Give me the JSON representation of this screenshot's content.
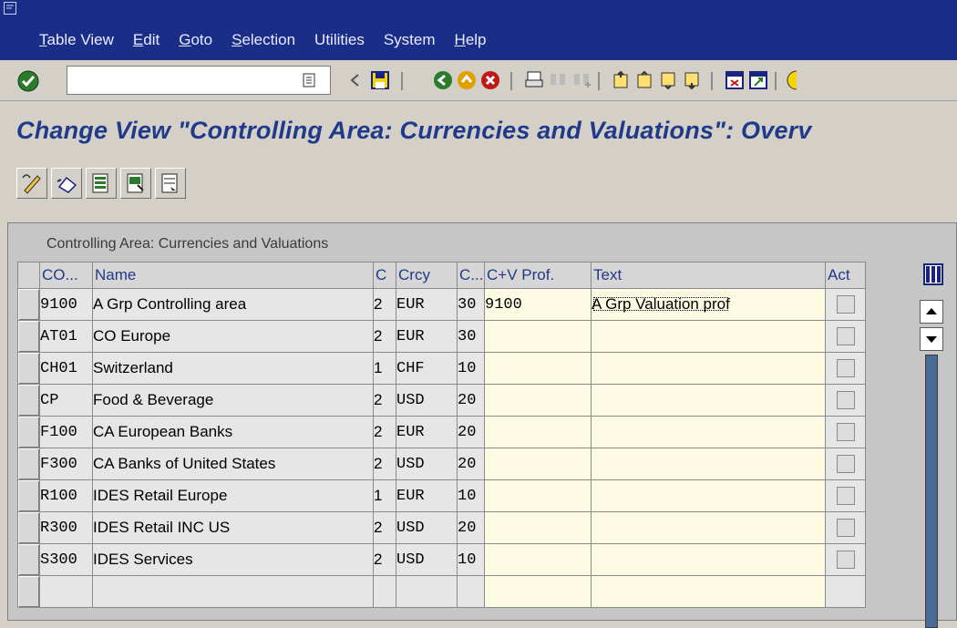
{
  "menu": [
    {
      "label": "Table View",
      "underline": "T"
    },
    {
      "label": "Edit",
      "underline": "E"
    },
    {
      "label": "Goto",
      "underline": "G"
    },
    {
      "label": "Selection",
      "underline": "S"
    },
    {
      "label": "Utilities",
      "underline": ""
    },
    {
      "label": "System",
      "underline": ""
    },
    {
      "label": "Help",
      "underline": "H"
    }
  ],
  "toolbar": {
    "command_field_value": "",
    "icons": [
      "enter-icon",
      "back-arrow-icon",
      "save-icon",
      "back-icon",
      "exit-icon",
      "cancel-icon",
      "print-icon",
      "find-icon",
      "find-next-icon",
      "first-page-icon",
      "previous-page-icon",
      "next-page-icon",
      "last-page-icon",
      "create-session-icon",
      "shortcut-icon"
    ]
  },
  "page_title": "Change View \"Controlling Area: Currencies and Valuations\": Overv",
  "app_toolbar": [
    "change-display-icon",
    "undo-icon",
    "select-all-icon",
    "select-block-icon",
    "deselect-all-icon"
  ],
  "table": {
    "title": "Controlling Area: Currencies and Valuations",
    "columns": [
      "CO...",
      "Name",
      "C",
      "Crcy",
      "C...",
      "C+V Prof.",
      "Text",
      "Act"
    ],
    "rows": [
      {
        "co": "9100",
        "name": "A Grp Controlling area",
        "c": "2",
        "crcy": "EUR",
        "c2": "30",
        "cv": "9100",
        "text": "A Grp Valuation prof",
        "act": false
      },
      {
        "co": "AT01",
        "name": "CO Europe",
        "c": "2",
        "crcy": "EUR",
        "c2": "30",
        "cv": "",
        "text": "",
        "act": false
      },
      {
        "co": "CH01",
        "name": "Switzerland",
        "c": "1",
        "crcy": "CHF",
        "c2": "10",
        "cv": "",
        "text": "",
        "act": false
      },
      {
        "co": "CP",
        "name": "Food & Beverage",
        "c": "2",
        "crcy": "USD",
        "c2": "20",
        "cv": "",
        "text": "",
        "act": false
      },
      {
        "co": "F100",
        "name": "CA European Banks",
        "c": "2",
        "crcy": "EUR",
        "c2": "20",
        "cv": "",
        "text": "",
        "act": false
      },
      {
        "co": "F300",
        "name": "CA Banks of United States",
        "c": "2",
        "crcy": "USD",
        "c2": "20",
        "cv": "",
        "text": "",
        "act": false
      },
      {
        "co": "R100",
        "name": "IDES Retail Europe",
        "c": "1",
        "crcy": "EUR",
        "c2": "10",
        "cv": "",
        "text": "",
        "act": false
      },
      {
        "co": "R300",
        "name": "IDES Retail INC US",
        "c": "2",
        "crcy": "USD",
        "c2": "20",
        "cv": "",
        "text": "",
        "act": false
      },
      {
        "co": "S300",
        "name": "IDES Services",
        "c": "2",
        "crcy": "USD",
        "c2": "10",
        "cv": "",
        "text": "",
        "act": false
      },
      {
        "co": "",
        "name": "",
        "c": "",
        "crcy": "",
        "c2": "",
        "cv": "",
        "text": "",
        "act": null
      }
    ]
  },
  "colors": {
    "menubar": "#1a2e88",
    "title": "#1f3a8a",
    "editable_cell": "#fdfbe3",
    "scrollbar": "#4a6a96"
  }
}
